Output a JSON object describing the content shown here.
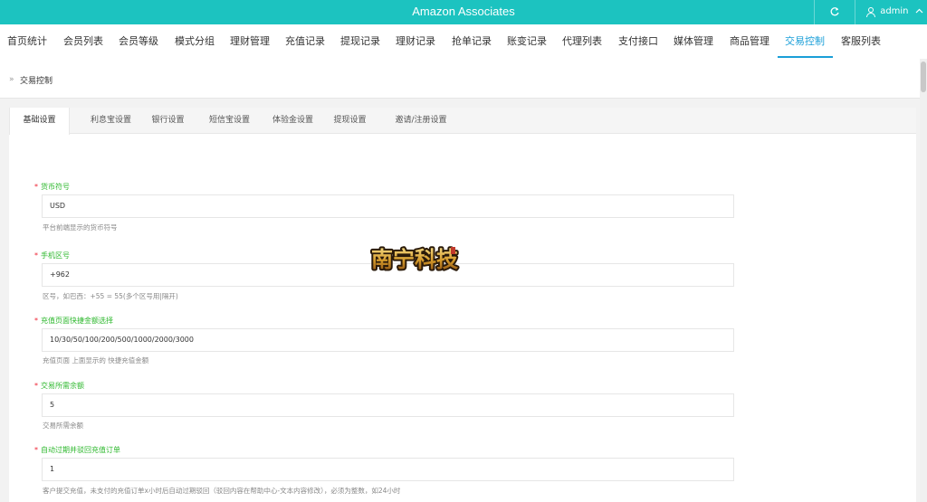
{
  "header": {
    "title": "Amazon Associates",
    "refresh_icon": "refresh-icon",
    "user_icon": "user-icon",
    "user_name": "admin",
    "user_caret": "^"
  },
  "menu": {
    "items": [
      "首页统计",
      "会员列表",
      "会员等级",
      "模式分组",
      "理财管理",
      "充值记录",
      "提现记录",
      "理财记录",
      "抢单记录",
      "账变记录",
      "代理列表",
      "支付接口",
      "媒体管理",
      "商品管理",
      "交易控制",
      "客服列表"
    ],
    "active_index": 14,
    "active_color": "#1a9fd8"
  },
  "breadcrumb": {
    "chevron": "»",
    "current": "交易控制"
  },
  "tabs": {
    "items": [
      "基础设置",
      "利息宝设置",
      "银行设置",
      "短信宝设置",
      "体验金设置",
      "提现设置",
      "邀请/注册设置"
    ],
    "active_index": 0
  },
  "form": {
    "required_mark": "*",
    "fields": [
      {
        "label": "货币符号",
        "value": "USD",
        "help": "平台前端显示的货币符号"
      },
      {
        "label": "手机区号",
        "value": "+962",
        "help": "区号，如巴西：+55 = 55(多个区号用|隔开)"
      },
      {
        "label": "充值页面快捷金额选择",
        "value": "10/30/50/100/200/500/1000/2000/3000",
        "help": "充值页面 上面显示的 快捷充值金额"
      },
      {
        "label": "交易所需余额",
        "value": "5",
        "help": "交易所需余额"
      },
      {
        "label": "自动过期并驳回充值订单",
        "value": "1",
        "help": "客户提交充值，未支付的充值订单x小时后自动过期驳回（驳回内容在帮助中心-文本内容修改），必须为整数，如24小时"
      }
    ]
  },
  "watermark": {
    "text": "南宁科技",
    "kind": "logo"
  },
  "colors": {
    "topbar": "#1cc3c0",
    "label_green": "#2eb82e",
    "required_red": "#e23"
  }
}
